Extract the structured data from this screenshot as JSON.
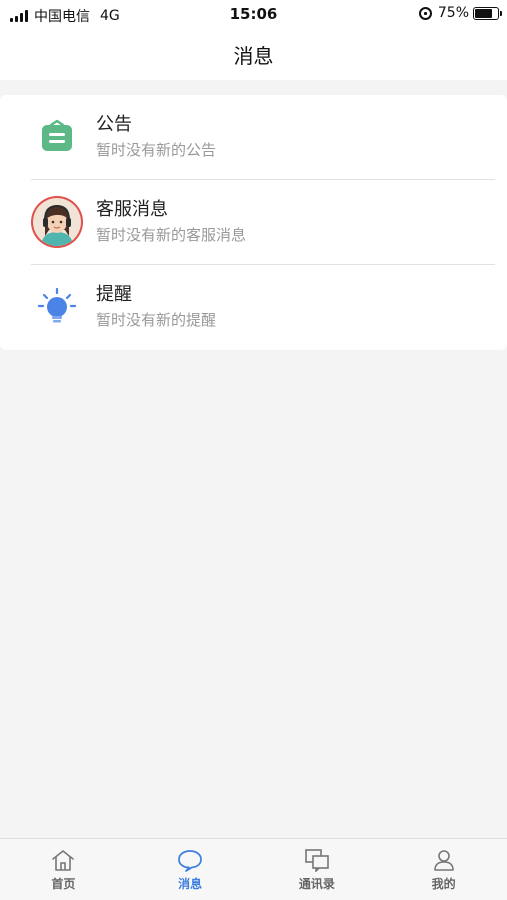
{
  "status_bar": {
    "carrier": "中国电信",
    "network": "4G",
    "time": "15:06",
    "battery": "75%",
    "battery_level": 0.75
  },
  "nav": {
    "title": "消息"
  },
  "messages": [
    {
      "title": "公告",
      "subtitle": "暂时没有新的公告",
      "icon": "announcement-icon",
      "color": "#5cb885"
    },
    {
      "title": "客服消息",
      "subtitle": "暂时没有新的客服消息",
      "icon": "customer-service-avatar",
      "color": "#e0504d"
    },
    {
      "title": "提醒",
      "subtitle": "暂时没有新的提醒",
      "icon": "lightbulb-icon",
      "color": "#4b84e6"
    }
  ],
  "tabs": [
    {
      "label": "首页",
      "icon": "home-icon",
      "active": false
    },
    {
      "label": "消息",
      "icon": "message-bubble-icon",
      "active": true
    },
    {
      "label": "通讯录",
      "icon": "contacts-icon",
      "active": false
    },
    {
      "label": "我的",
      "icon": "profile-icon",
      "active": false
    }
  ],
  "colors": {
    "accent": "#3d7de0",
    "inactive": "#666666",
    "background": "#f4f4f4"
  }
}
